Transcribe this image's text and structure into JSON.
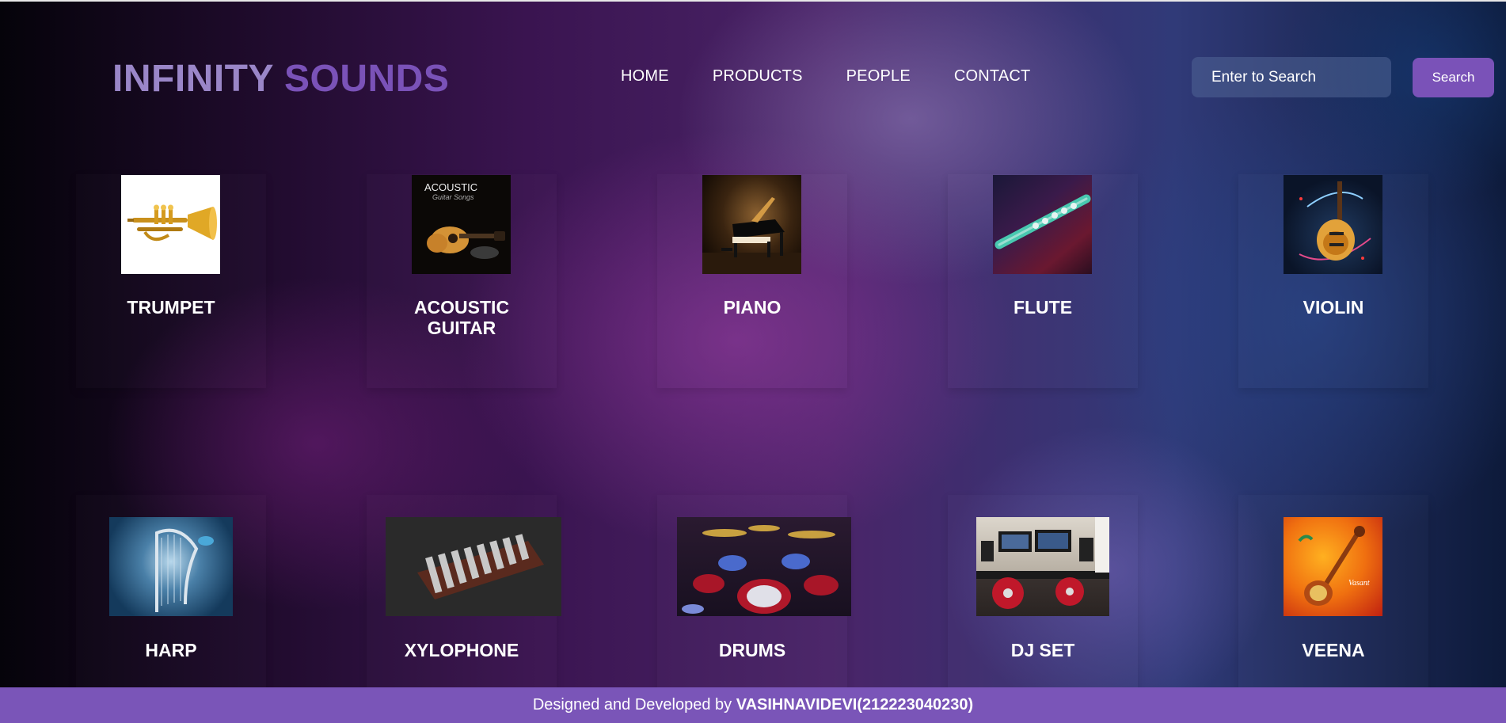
{
  "brand": {
    "word1": "INFINITY",
    "word2": "SOUNDS"
  },
  "nav": [
    {
      "label": "HOME"
    },
    {
      "label": "PRODUCTS"
    },
    {
      "label": "PEOPLE"
    },
    {
      "label": "CONTACT"
    }
  ],
  "search": {
    "placeholder": "Enter to Search",
    "button_label": "Search"
  },
  "products": [
    {
      "name": "TRUMPET",
      "icon": "trumpet-image"
    },
    {
      "name": "ACOUSTIC GUITAR",
      "icon": "acoustic-guitar-image",
      "image_text_1": "ACOUSTIC",
      "image_text_2": "Guitar Songs"
    },
    {
      "name": "PIANO",
      "icon": "piano-image"
    },
    {
      "name": "FLUTE",
      "icon": "flute-image"
    },
    {
      "name": "VIOLIN",
      "icon": "electric-guitar-image"
    },
    {
      "name": "HARP",
      "icon": "harp-image"
    },
    {
      "name": "XYLOPHONE",
      "icon": "xylophone-image"
    },
    {
      "name": "DRUMS",
      "icon": "drums-image"
    },
    {
      "name": "DJ SET",
      "icon": "dj-set-image"
    },
    {
      "name": "VEENA",
      "icon": "veena-image",
      "image_text_1": "Vasant"
    }
  ],
  "footer": {
    "prefix": "Designed and Developed by ",
    "author": "VASIHNAVIDEVI(212223040230)"
  },
  "colors": {
    "accent": "#7a52b8",
    "logo_light": "#9a86c8",
    "footer": "#7a55b8"
  }
}
